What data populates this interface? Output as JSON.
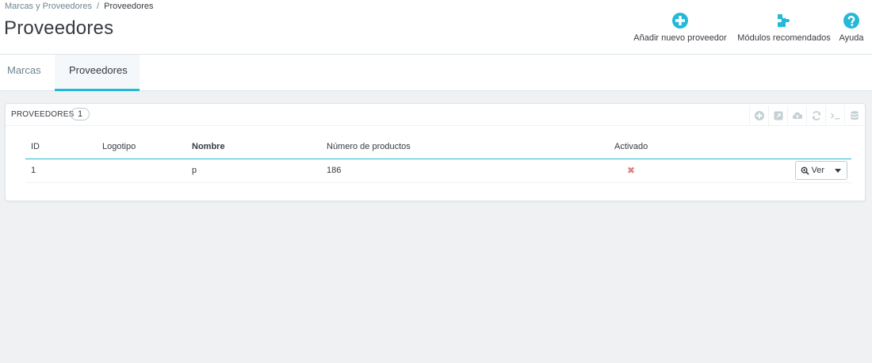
{
  "breadcrumb": {
    "parent": "Marcas y Proveedores",
    "separator": "/",
    "current": "Proveedores"
  },
  "page": {
    "title": "Proveedores"
  },
  "toolbar": {
    "add_label": "Añadir nuevo proveedor",
    "modules_label": "Módulos recomendados",
    "help_label": "Ayuda",
    "add_icon": "plus-circle-icon",
    "modules_icon": "puzzle-icon",
    "help_icon": "question-circle-icon",
    "accent_color": "#25b9d7"
  },
  "tabs": [
    {
      "label": "Marcas",
      "active": false
    },
    {
      "label": "Proveedores",
      "active": true
    }
  ],
  "panel": {
    "title": "PROVEEDORES",
    "count": "1",
    "actions": [
      "add-icon",
      "export-icon",
      "cloud-icon",
      "refresh-icon",
      "sql-icon",
      "database-icon"
    ]
  },
  "table": {
    "columns": [
      "ID",
      "Logotipo",
      "Nombre",
      "Número de productos",
      "Activado"
    ],
    "rows": [
      {
        "id": "1",
        "logo": "",
        "name": "p",
        "products": "186",
        "active": false,
        "action_label": "Ver"
      }
    ]
  }
}
